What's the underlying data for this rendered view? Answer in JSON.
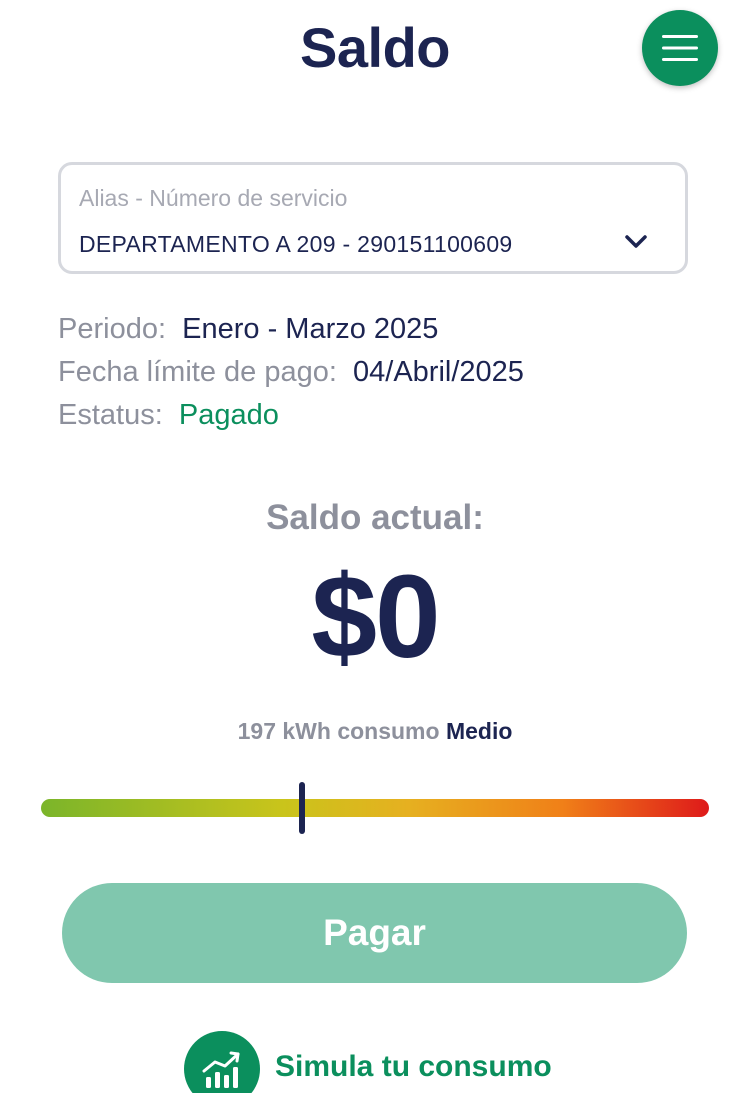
{
  "header": {
    "title": "Saldo",
    "menu_icon": "hamburger-menu-icon"
  },
  "service_select": {
    "label": "Alias - Número de servicio",
    "value": "DEPARTAMENTO A 209 - 290151100609",
    "icon": "chevron-down-icon"
  },
  "info": {
    "periodo_label": "Periodo:",
    "periodo_value": "Enero - Marzo 2025",
    "fecha_label": "Fecha límite de pago:",
    "fecha_value": "04/Abril/2025",
    "estatus_label": "Estatus:",
    "estatus_value": "Pagado"
  },
  "balance": {
    "label": "Saldo actual:",
    "amount": "$0"
  },
  "consumption": {
    "text": "197 kWh consumo",
    "level": "Medio",
    "gauge_fraction": 0.39
  },
  "actions": {
    "pay_label": "Pagar",
    "simulate_label": "Simula tu consumo",
    "simulate_icon": "bar-chart-growth-icon"
  },
  "colors": {
    "brand_green": "#0b8f5d",
    "navy": "#1c2451",
    "pay_button_disabled": "#80c7ae",
    "muted_text": "#8d909c"
  }
}
